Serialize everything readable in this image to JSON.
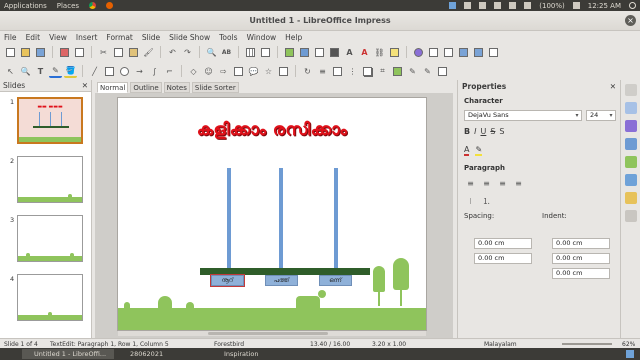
{
  "top_panel": {
    "applications": "Applications",
    "places": "Places",
    "battery": "(100%)",
    "time": "12:25 AM"
  },
  "window": {
    "title": "Untitled 1 - LibreOffice Impress"
  },
  "menu": [
    "File",
    "Edit",
    "View",
    "Insert",
    "Format",
    "Slide",
    "Slide Show",
    "Tools",
    "Window",
    "Help"
  ],
  "slides_pane": {
    "title": "Slides",
    "numbers": [
      "1",
      "2",
      "3",
      "4"
    ]
  },
  "view_tabs": [
    "Normal",
    "Outline",
    "Notes",
    "Slide Sorter"
  ],
  "slide": {
    "title": "കളിക്കാം രസിക്കാം",
    "labels": [
      "നൂറ്",
      "പത്ത്",
      "ഒന്ന്"
    ]
  },
  "properties": {
    "title": "Properties",
    "character": "Character",
    "font_name": "DejaVu Sans",
    "font_size": "24",
    "paragraph": "Paragraph",
    "spacing": "Spacing:",
    "indent": "Indent:",
    "spacing_values": [
      "0.00 cm",
      "0.00 cm"
    ],
    "indent_values": [
      "0.00 cm",
      "0.00 cm",
      "0.00 cm"
    ]
  },
  "status": {
    "slide": "Slide 1 of 4",
    "edit": "TextEdit: Paragraph 1, Row 1, Column 5",
    "layout": "Forestbird",
    "pos": "13.40 / 16.00",
    "size": "3.20 x 1.00",
    "lang": "Malayalam",
    "zoom": "62%"
  },
  "taskbar": {
    "task1": "Untitled 1 - LibreOffi...",
    "task2": "28062021",
    "task3": "Inspiration"
  },
  "colors": {
    "title_red": "#e0111a",
    "pole_blue": "#6e9bd3",
    "beam_green": "#2f5d2a",
    "grass": "#8fc45c",
    "selection": "#c9781f"
  }
}
